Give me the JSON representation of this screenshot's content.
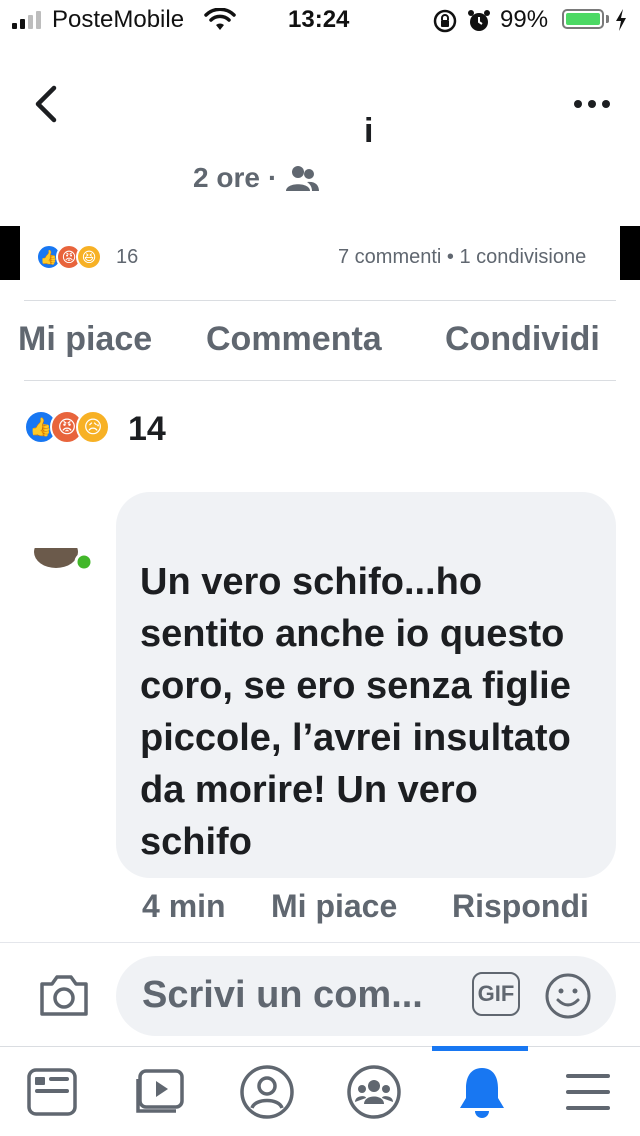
{
  "status_bar": {
    "carrier": "PosteMobile",
    "time": "13:24",
    "battery_percent": "99%",
    "battery_level": 0.99,
    "colors": {
      "battery": "#4cd964"
    }
  },
  "header": {
    "author_name_fragment": "i",
    "time_ago": "2 ore",
    "separator": "·",
    "audience_icon": "friends-icon"
  },
  "reactions_summary": {
    "icons": [
      "like-reaction-icon",
      "angry-reaction-icon",
      "haha-reaction-icon"
    ],
    "count": "16",
    "comments_shares": "7 commenti • 1 condivisione"
  },
  "actions": {
    "like": "Mi piace",
    "comment": "Commenta",
    "share": "Condividi"
  },
  "comment_reactions": {
    "icons": [
      "like-reaction-icon",
      "angry-reaction-icon",
      "sad-reaction-icon"
    ],
    "count": "14"
  },
  "comment": {
    "text": "Un vero schifo...ho sentito anche io questo coro, se ero senza figlie piccole, l’avrei insultato da morire! Un vero schifo",
    "time": "4 min",
    "like_label": "Mi piace",
    "reply_label": "Rispondi"
  },
  "composer": {
    "placeholder": "Scrivi un com...",
    "gif_label": "GIF"
  },
  "tab_bar": {
    "tabs": [
      "news-feed-icon",
      "video-icon",
      "profile-icon",
      "groups-icon",
      "notifications-icon",
      "menu-icon"
    ],
    "active": "notifications-icon"
  },
  "colors": {
    "accent": "#1877f2",
    "secondary_text": "#606770",
    "bubble": "#f0f2f5"
  }
}
